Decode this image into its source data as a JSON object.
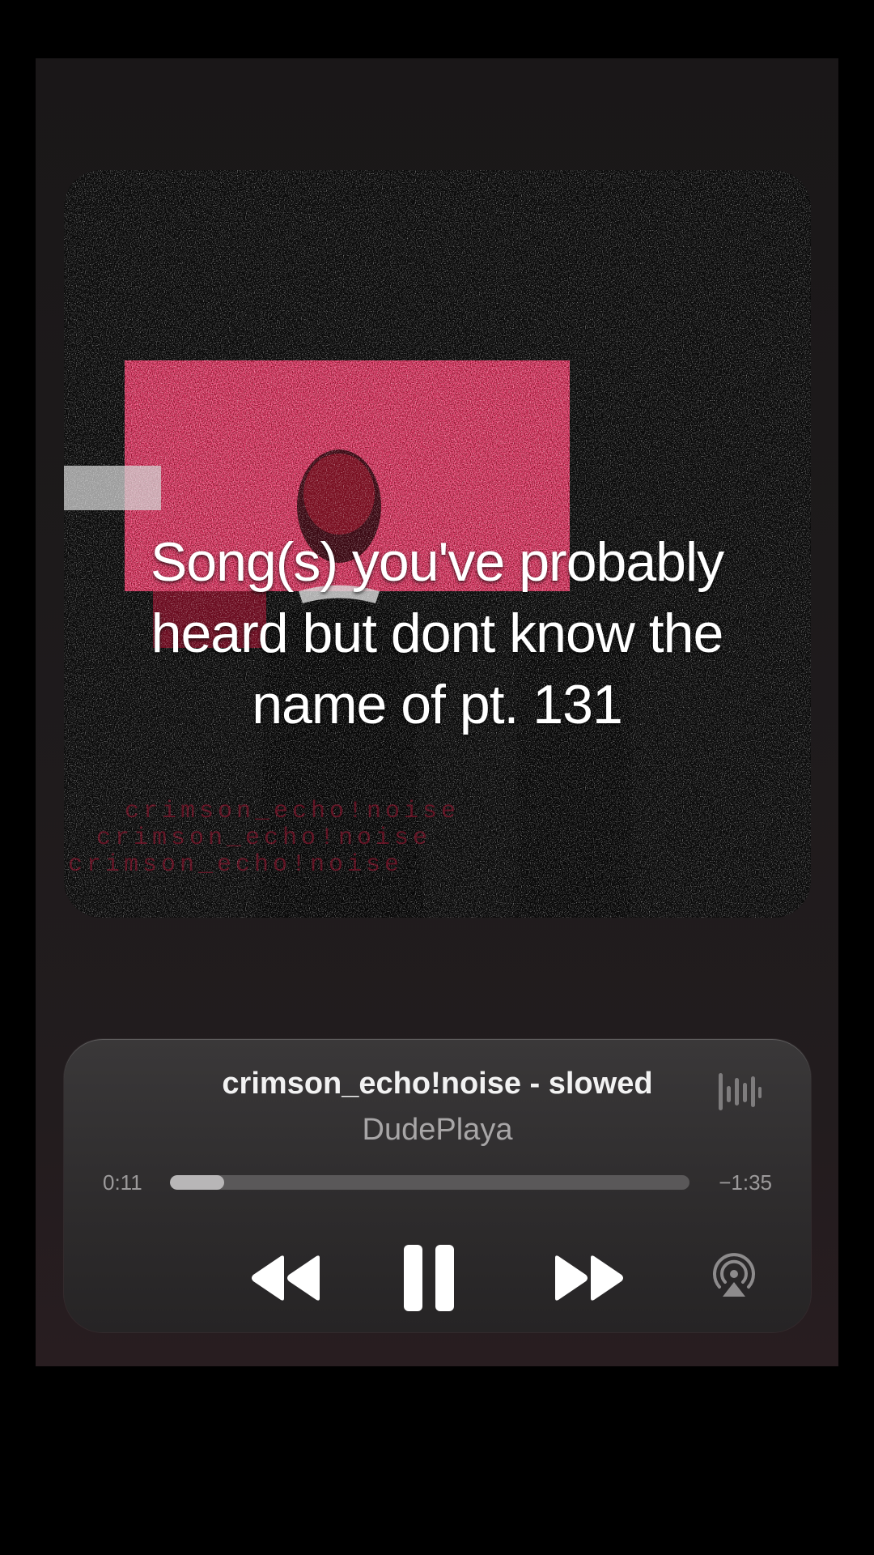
{
  "overlay": {
    "caption": "Song(s) you've probably\nheard but dont know the\nname of pt. 131"
  },
  "artwork": {
    "watermark_lines": [
      "crimson_echo!noise",
      "crimson_echo!noise",
      "crimson_echo!noise"
    ]
  },
  "player": {
    "title": "crimson_echo!noise - slowed",
    "artist": "DudePlaya",
    "elapsed": "0:11",
    "remaining": "−1:35",
    "progress": 0.105,
    "icons": {
      "waveform": "waveform-icon",
      "rewind": "rewind-icon",
      "pause": "pause-icon",
      "forward": "fast-forward-icon",
      "airplay": "airplay-icon"
    }
  },
  "colors": {
    "accent_red": "#d0103a",
    "panel": "#2e2c2d"
  }
}
